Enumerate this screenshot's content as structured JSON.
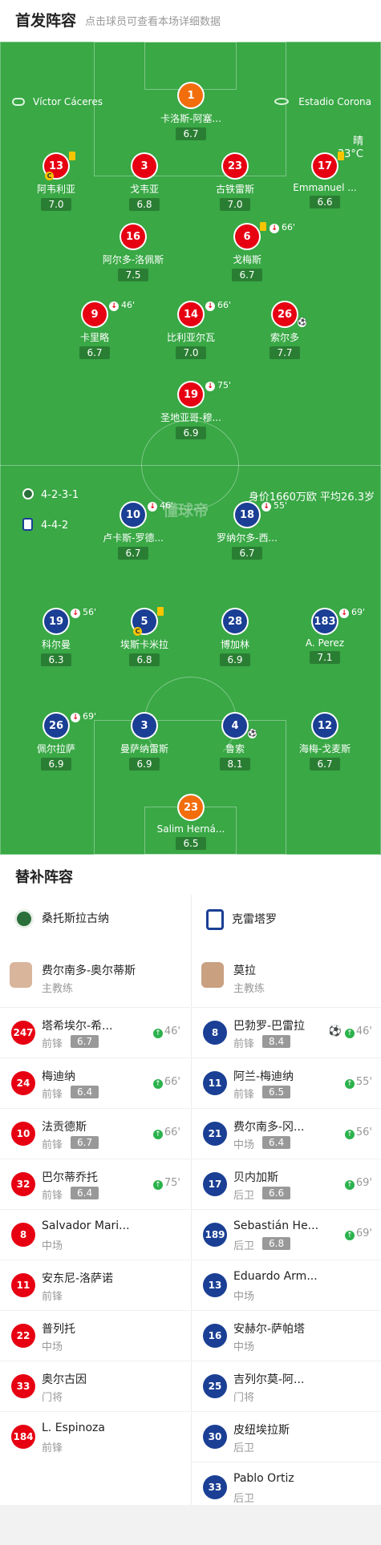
{
  "header": {
    "title": "首发阵容",
    "subtitle": "点击球员可查看本场详细数据"
  },
  "pitch": {
    "referee": "Víctor Cáceres",
    "stadium": "Estadio Corona",
    "weather": "晴",
    "temp": "33°C",
    "watermark": "懂球帝",
    "home_formation": "4-2-3-1",
    "away_formation": "4-4-2",
    "home_value": "身价1660万欧 平均26.3岁"
  },
  "home_players": [
    {
      "num": "1",
      "name": "卡洛斯-阿塞...",
      "rating": "6.7",
      "gk": true
    },
    {
      "num": "13",
      "name": "阿韦利亚",
      "rating": "7.0",
      "yellow": true,
      "captain": true
    },
    {
      "num": "3",
      "name": "戈韦亚",
      "rating": "6.8"
    },
    {
      "num": "23",
      "name": "古铁雷斯",
      "rating": "7.0"
    },
    {
      "num": "17",
      "name": "Emmanuel ...",
      "rating": "6.6",
      "yellow": true
    },
    {
      "num": "16",
      "name": "阿尔多-洛佩斯",
      "rating": "7.5"
    },
    {
      "num": "6",
      "name": "戈梅斯",
      "rating": "6.7",
      "yellow": true,
      "sub": "66'"
    },
    {
      "num": "9",
      "name": "卡里略",
      "rating": "6.7",
      "sub": "46'"
    },
    {
      "num": "14",
      "name": "比利亚尔瓦",
      "rating": "7.0",
      "sub": "66'"
    },
    {
      "num": "26",
      "name": "索尔多",
      "rating": "7.7",
      "goal": true
    },
    {
      "num": "19",
      "name": "圣地亚哥-穆...",
      "rating": "6.9",
      "sub": "75'"
    }
  ],
  "away_players": [
    {
      "num": "10",
      "name": "卢卡斯-罗德...",
      "rating": "6.7",
      "sub": "46'"
    },
    {
      "num": "18",
      "name": "罗纳尔多-西...",
      "rating": "6.7",
      "sub": "55'"
    },
    {
      "num": "19",
      "name": "科尔曼",
      "rating": "6.3",
      "sub": "56'"
    },
    {
      "num": "5",
      "name": "埃斯卡米拉",
      "rating": "6.8",
      "yellow": true,
      "captain": true
    },
    {
      "num": "28",
      "name": "博加林",
      "rating": "6.9"
    },
    {
      "num": "183",
      "name": "A. Perez",
      "rating": "7.1",
      "sub": "69'"
    },
    {
      "num": "26",
      "name": "佩尔拉萨",
      "rating": "6.9",
      "sub": "69'"
    },
    {
      "num": "3",
      "name": "曼萨纳雷斯",
      "rating": "6.9"
    },
    {
      "num": "4",
      "name": "鲁索",
      "rating": "8.1",
      "goal": true
    },
    {
      "num": "12",
      "name": "海梅-戈麦斯",
      "rating": "6.7"
    },
    {
      "num": "23",
      "name": "Salim Herná...",
      "rating": "6.5",
      "gk": true
    }
  ],
  "subs": {
    "title": "替补阵容",
    "home": {
      "team": "桑托斯拉古纳",
      "coach": "费尔南多-奥尔蒂斯",
      "coach_role": "主教练",
      "players": [
        {
          "num": "247",
          "name": "塔希埃尔-希...",
          "pos": "前锋",
          "rating": "6.7",
          "min": "46'"
        },
        {
          "num": "24",
          "name": "梅迪纳",
          "pos": "前锋",
          "rating": "6.4",
          "min": "66'"
        },
        {
          "num": "10",
          "name": "法贡德斯",
          "pos": "前锋",
          "rating": "6.7",
          "min": "66'"
        },
        {
          "num": "32",
          "name": "巴尔蒂乔托",
          "pos": "前锋",
          "rating": "6.4",
          "min": "75'"
        },
        {
          "num": "8",
          "name": "Salvador Mari...",
          "pos": "中场"
        },
        {
          "num": "11",
          "name": "安东尼-洛萨诺",
          "pos": "前锋"
        },
        {
          "num": "22",
          "name": "普列托",
          "pos": "中场"
        },
        {
          "num": "33",
          "name": "奥尔古因",
          "pos": "门将"
        },
        {
          "num": "184",
          "name": "L. Espinoza",
          "pos": "前锋"
        }
      ]
    },
    "away": {
      "team": "克雷塔罗",
      "coach": "莫拉",
      "coach_role": "主教练",
      "players": [
        {
          "num": "8",
          "name": "巴勃罗-巴雷拉",
          "pos": "前锋",
          "rating": "8.4",
          "min": "46'",
          "goal": true
        },
        {
          "num": "11",
          "name": "阿兰-梅迪纳",
          "pos": "前锋",
          "rating": "6.5",
          "min": "55'"
        },
        {
          "num": "21",
          "name": "费尔南多-冈...",
          "pos": "中场",
          "rating": "6.4",
          "min": "56'"
        },
        {
          "num": "17",
          "name": "贝内加斯",
          "pos": "后卫",
          "rating": "6.6",
          "min": "69'"
        },
        {
          "num": "189",
          "name": "Sebastián He...",
          "pos": "后卫",
          "rating": "6.8",
          "min": "69'"
        },
        {
          "num": "13",
          "name": "Eduardo Arm...",
          "pos": "中场"
        },
        {
          "num": "16",
          "name": "安赫尔-萨帕塔",
          "pos": "中场"
        },
        {
          "num": "25",
          "name": "吉列尔莫-阿...",
          "pos": "门将"
        },
        {
          "num": "30",
          "name": "皮纽埃拉斯",
          "pos": "后卫"
        },
        {
          "num": "33",
          "name": "Pablo Ortiz",
          "pos": "后卫"
        }
      ]
    }
  }
}
